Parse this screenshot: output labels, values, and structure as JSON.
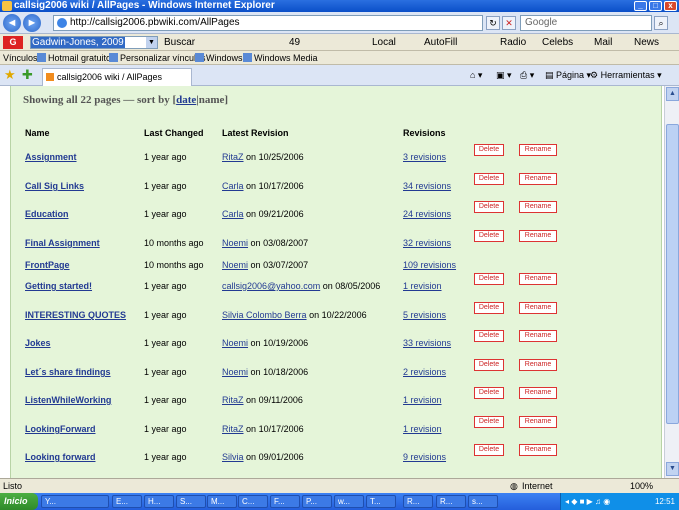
{
  "window": {
    "title": "callsig2006 wiki / AllPages - Windows Internet Explorer",
    "minimize": "_",
    "maximize": "□",
    "close": "x"
  },
  "address": {
    "url": "http://callsig2006.pbwiki.com/AllPages",
    "search_placeholder": "Google",
    "back_glyph": "◄",
    "forward_glyph": "►",
    "refresh_glyph": "↻",
    "stop_glyph": "✕",
    "go_glyph": "⌕"
  },
  "google_toolbar": {
    "logo": "G",
    "search_value": "Gadwin-Jones, 2009",
    "items": [
      {
        "label": "Buscar"
      },
      {
        "label": "49"
      },
      {
        "label": "Local"
      },
      {
        "label": "AutoFill"
      },
      {
        "label": "Radio"
      },
      {
        "label": "Celebs"
      },
      {
        "label": "Mail"
      },
      {
        "label": "News"
      }
    ]
  },
  "links_bar": {
    "label": "Vínculos",
    "links": [
      "Hotmail gratuito",
      "Personalizar vínculos",
      "Windows",
      "Windows Media"
    ]
  },
  "tab_bar": {
    "tab_title": "callsig2006 wiki / AllPages",
    "page_menu": "Página",
    "tools_menu": "Herramientas"
  },
  "page": {
    "showing_prefix": "Showing all 22 pages — sort by [",
    "sort_date": "date",
    "sort_sep": "|",
    "sort_name": "name",
    "sort_suffix": "]",
    "headers": {
      "name": "Name",
      "changed": "Last Changed",
      "revision": "Latest Revision",
      "revisions": "Revisions"
    },
    "delete_label": "Delete",
    "rename_label": "Rename",
    "on_word": "on",
    "rows": [
      {
        "name": "Assignment",
        "changed": "1 year ago",
        "user": "RitaZ",
        "date": "10/25/2006",
        "revisions": "3 revisions",
        "buttons": true
      },
      {
        "name": "Call Sig Links",
        "changed": "1 year ago",
        "user": "Carla",
        "date": "10/17/2006",
        "revisions": "34 revisions",
        "buttons": true
      },
      {
        "name": "Education",
        "changed": "1 year ago",
        "user": "Carla",
        "date": "09/21/2006",
        "revisions": "24 revisions",
        "buttons": true
      },
      {
        "name": "Final Assignment",
        "changed": "10 months ago",
        "user": "Noemi",
        "date": "03/08/2007",
        "revisions": "32 revisions",
        "buttons": true
      },
      {
        "name": "FrontPage",
        "changed": "10 months ago",
        "user": "Noemi",
        "date": "03/07/2007",
        "revisions": "109 revisions",
        "buttons": false
      },
      {
        "name": "Getting started!",
        "changed": "1 year ago",
        "user": "callsig2006@yahoo.com",
        "date": "08/05/2006",
        "revisions": "1 revision",
        "buttons": true
      },
      {
        "name": "INTERESTING QUOTES",
        "changed": "1 year ago",
        "user": "Silvia Colombo Berra",
        "date": "10/22/2006",
        "revisions": "5 revisions",
        "buttons": true
      },
      {
        "name": "Jokes",
        "changed": "1 year ago",
        "user": "Noemi",
        "date": "10/19/2006",
        "revisions": "33 revisions",
        "buttons": true
      },
      {
        "name": "Let´s share findings",
        "changed": "1 year ago",
        "user": "Noemi",
        "date": "10/18/2006",
        "revisions": "2 revisions",
        "buttons": true
      },
      {
        "name": "ListenWhileWorking",
        "changed": "1 year ago",
        "user": "RitaZ",
        "date": "09/11/2006",
        "revisions": "1 revision",
        "buttons": true
      },
      {
        "name": "LookingForward",
        "changed": "1 year ago",
        "user": "RitaZ",
        "date": "10/17/2006",
        "revisions": "1 revision",
        "buttons": true
      },
      {
        "name": "Looking forward",
        "changed": "1 year ago",
        "user": "Silvia",
        "date": "09/01/2006",
        "revisions": "9 revisions",
        "buttons": true
      }
    ]
  },
  "status_bar": {
    "status": "Listo",
    "zone": "Internet",
    "zoom": "100%"
  },
  "taskbar": {
    "start": "Inicio",
    "items": [
      "Y...",
      "E...",
      "H...",
      "S...",
      "M...",
      "C...",
      "F...",
      "P...",
      "w...",
      "T...",
      "R...",
      "R...",
      "s..."
    ],
    "clock": "12:51"
  }
}
